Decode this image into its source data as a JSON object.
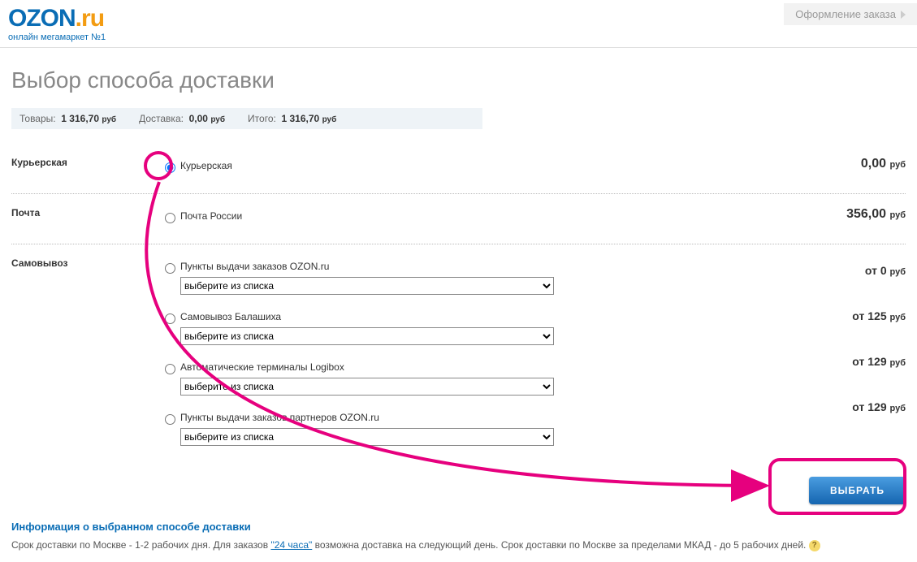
{
  "logo": {
    "ozon": "OZON",
    "dot": ".",
    "ru": "ru",
    "tagline": "онлайн мегамаркет №1"
  },
  "breadcrumb": {
    "label": "Оформление заказа"
  },
  "page_title": "Выбор способа доставки",
  "summary": {
    "goods_label": "Товары:",
    "goods_value": "1 316,70",
    "delivery_label": "Доставка:",
    "delivery_value": "0,00",
    "total_label": "Итого:",
    "total_value": "1 316,70",
    "currency": "руб"
  },
  "groups": {
    "courier": {
      "label": "Курьерская",
      "option_label": "Курьерская",
      "price": "0,00",
      "currency": "руб"
    },
    "post": {
      "label": "Почта",
      "option_label": "Почта России",
      "price": "356,00",
      "currency": "руб"
    },
    "pickup": {
      "label": "Самовывоз",
      "opt1": {
        "label": "Пункты выдачи заказов OZON.ru",
        "select_placeholder": "выберите из списка",
        "price_prefix": "от",
        "price": "0",
        "currency": "руб"
      },
      "opt2": {
        "label": "Самовывоз Балашиха",
        "select_placeholder": "выберите из списка",
        "price_prefix": "от",
        "price": "125",
        "currency": "руб"
      },
      "opt3": {
        "label": "Автоматические терминалы Logibox",
        "select_placeholder": "выберите из списка",
        "price_prefix": "от",
        "price": "129",
        "currency": "руб"
      },
      "opt4": {
        "label": "Пункты выдачи заказов партнеров OZON.ru",
        "select_placeholder": "выберите из списка",
        "price_prefix": "от",
        "price": "129",
        "currency": "руб"
      }
    }
  },
  "select_button": "ВЫБРАТЬ",
  "info": {
    "heading": "Информация о выбранном способе доставки",
    "text_part1": "Срок доставки по Москве - 1-2 рабочих дня. Для заказов ",
    "link_text": "\"24 часа\"",
    "text_part2": " возможна доставка на следующий день. Срок доставки по Москве за пределами МКАД - до 5 рабочих дней. ",
    "help_icon_char": "?"
  }
}
